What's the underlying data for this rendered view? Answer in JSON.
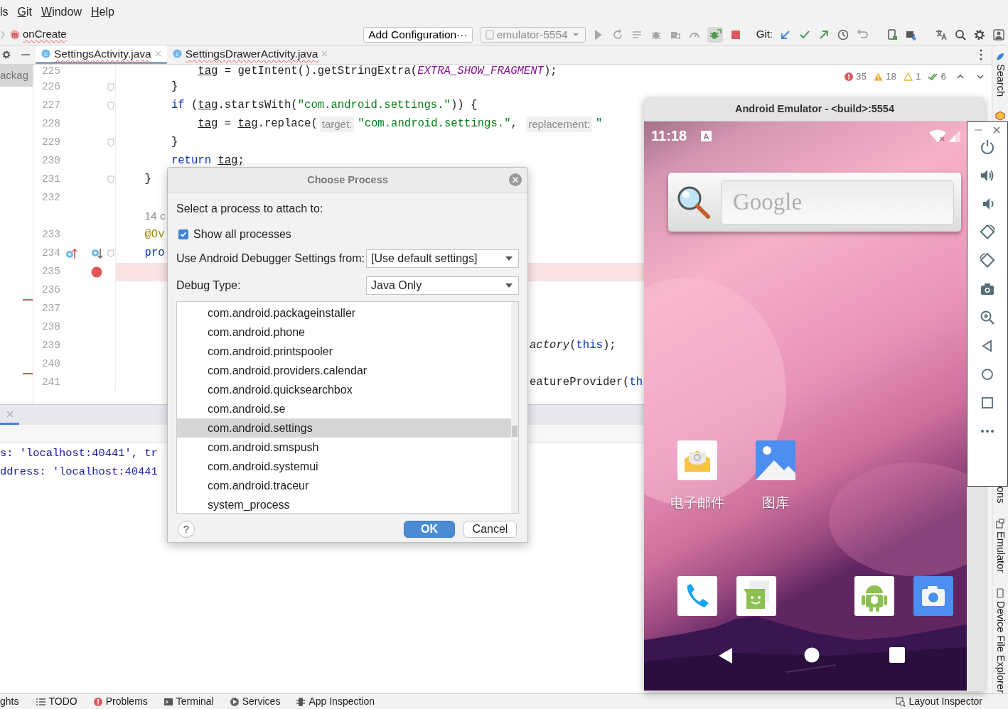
{
  "menu_bar": [
    {
      "label": "ls",
      "mnemonic": false
    },
    {
      "label": "Git",
      "mnemonic": true
    },
    {
      "label": "Window",
      "mnemonic": true
    },
    {
      "label": "Help",
      "mnemonic": true
    }
  ],
  "breadcrumb": {
    "icon_letter": "m",
    "label": "onCreate"
  },
  "toolbar": {
    "config_button": "Add Configuration···",
    "device": "emulator-5554",
    "git_label": "Git:"
  },
  "editor_tabs": [
    {
      "icon_letter": "c",
      "label": "SettingsActivity.java",
      "selected": true
    },
    {
      "icon_letter": "c",
      "label": "SettingsDrawerActivity.java",
      "selected": false
    }
  ],
  "project_panel": {
    "label": "ackag"
  },
  "inspections": {
    "errors": "35",
    "warnings": "18",
    "weak_warnings": "1",
    "passed": "6"
  },
  "code_lines": [
    {
      "number": "225",
      "segments": [
        {
          "text": "            tag",
          "kind": "var"
        },
        {
          "text": " = getIntent().getStringExtra(",
          "kind": "plain"
        },
        {
          "text": "EXTRA_SHOW_FRAGMENT",
          "kind": "const"
        },
        {
          "text": ");",
          "kind": "plain"
        }
      ]
    },
    {
      "number": "226",
      "fold": true,
      "segments": [
        {
          "text": "        }",
          "kind": "plain"
        }
      ]
    },
    {
      "number": "227",
      "fold": true,
      "segments": [
        {
          "text": "        if",
          "kind": "keyword"
        },
        {
          "text": " (",
          "kind": "plain"
        },
        {
          "text": "tag",
          "kind": "var"
        },
        {
          "text": ".startsWith(",
          "kind": "plain"
        },
        {
          "text": "\"com.android.settings.\"",
          "kind": "string"
        },
        {
          "text": ")) {",
          "kind": "plain"
        }
      ]
    },
    {
      "number": "228",
      "segments": [
        {
          "text": "            tag",
          "kind": "var"
        },
        {
          "text": " = ",
          "kind": "plain"
        },
        {
          "text": "tag",
          "kind": "var"
        },
        {
          "text": ".replace(",
          "kind": "plain"
        },
        {
          "text": "target:",
          "kind": "hint"
        },
        {
          "text": "\"com.android.settings.\"",
          "kind": "string"
        },
        {
          "text": ", ",
          "kind": "plain"
        },
        {
          "text": "replacement:",
          "kind": "hint"
        },
        {
          "text": "\"",
          "kind": "string"
        }
      ]
    },
    {
      "number": "229",
      "fold": true,
      "segments": [
        {
          "text": "        }",
          "kind": "plain"
        }
      ]
    },
    {
      "number": "230",
      "segments": [
        {
          "text": "        return",
          "kind": "keyword"
        },
        {
          "text": " tag",
          "kind": "var"
        },
        {
          "text": ";",
          "kind": "plain"
        }
      ]
    },
    {
      "number": "231",
      "fold": true,
      "segments": [
        {
          "text": "    }",
          "kind": "plain"
        }
      ]
    },
    {
      "number": "232"
    },
    {
      "segments": [
        {
          "text": "    14 c",
          "kind": "inlay"
        }
      ]
    },
    {
      "number": "233",
      "segments": [
        {
          "text": "    @Ov",
          "kind": "annotation"
        }
      ]
    },
    {
      "number": "234",
      "fold": true,
      "overrides": true,
      "overridden": true,
      "segments": [
        {
          "text": "    pro",
          "kind": "keyword"
        }
      ]
    },
    {
      "number": "235",
      "breakpoint": true
    },
    {
      "number": "236"
    },
    {
      "number": "237",
      "deleted_above": true
    },
    {
      "number": "238"
    },
    {
      "number": "239",
      "after_dialog": [
        {
          "text": "actory",
          "kind": "italic"
        },
        {
          "text": "(",
          "kind": "plain"
        },
        {
          "text": "this",
          "kind": "keyword"
        },
        {
          "text": ");",
          "kind": "plain"
        }
      ]
    },
    {
      "number": "240"
    },
    {
      "number": "241",
      "deleted_above": true,
      "after_dialog": [
        {
          "text": "eatureProvider(",
          "kind": "plain"
        },
        {
          "text": "th",
          "kind": "keyword"
        }
      ]
    }
  ],
  "console_tab": {
    "selected": true
  },
  "console_lines": [
    "s: 'localhost:40441', tr",
    "ddress: 'localhost:40441"
  ],
  "bottom_tools": [
    {
      "label": "ghts",
      "kind": "plain"
    },
    {
      "label": "TODO",
      "kind": "todo"
    },
    {
      "label": "Problems",
      "kind": "problems"
    },
    {
      "label": "Terminal",
      "kind": "terminal"
    },
    {
      "label": "Services",
      "kind": "services"
    },
    {
      "label": "App Inspection",
      "kind": "inspection"
    }
  ],
  "layout_inspector": "Layout Inspector",
  "right_tools": [
    {
      "label": "Search",
      "kind": "search"
    },
    {
      "label": "ons",
      "kind": "plain"
    },
    {
      "label": "Emulator",
      "kind": "emulator"
    },
    {
      "label": "Device File Explorer",
      "kind": "device"
    }
  ],
  "dialog": {
    "title": "Choose Process",
    "prompt": "Select a process to attach to:",
    "show_all": {
      "label": "Show all processes",
      "checked": true
    },
    "settings_label": "Use Android Debugger Settings from:",
    "settings_value": "[Use default settings]",
    "debug_type_label": "Debug Type:",
    "debug_type_value": "Java Only",
    "processes": [
      {
        "name": "com.android.packageinstaller",
        "selected": false
      },
      {
        "name": "com.android.phone",
        "selected": false
      },
      {
        "name": "com.android.printspooler",
        "selected": false
      },
      {
        "name": "com.android.providers.calendar",
        "selected": false
      },
      {
        "name": "com.android.quicksearchbox",
        "selected": false
      },
      {
        "name": "com.android.se",
        "selected": false
      },
      {
        "name": "com.android.settings",
        "selected": true
      },
      {
        "name": "com.android.smspush",
        "selected": false
      },
      {
        "name": "com.android.systemui",
        "selected": false
      },
      {
        "name": "com.android.traceur",
        "selected": false
      },
      {
        "name": "system_process",
        "selected": false
      }
    ],
    "help": "?",
    "ok": "OK",
    "cancel": "Cancel"
  },
  "emulator": {
    "title": "Android Emulator - <build>:5554",
    "time": "11:18",
    "notification_letter": "A",
    "search_placeholder": "Google",
    "apps": [
      {
        "label": "电子邮件",
        "kind": "email"
      },
      {
        "label": "图库",
        "kind": "gallery"
      }
    ],
    "dock": [
      {
        "kind": "phone"
      },
      {
        "kind": "messaging"
      },
      {
        "kind": "empty"
      },
      {
        "kind": "android"
      },
      {
        "kind": "camera"
      }
    ]
  }
}
